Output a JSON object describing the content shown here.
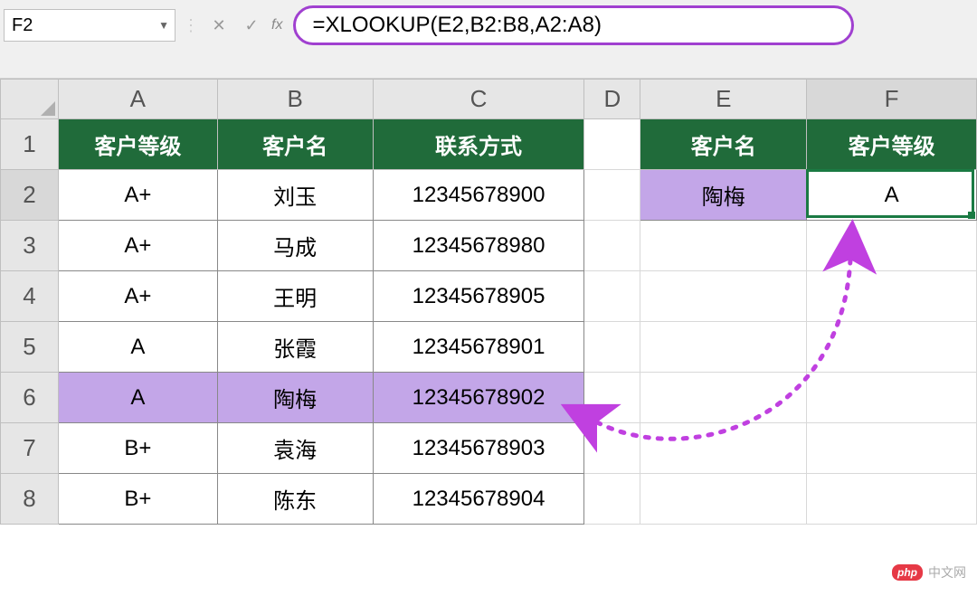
{
  "formula_bar": {
    "cell_ref": "F2",
    "formula": "=XLOOKUP(E2,B2:B8,A2:A8)"
  },
  "columns": [
    "A",
    "B",
    "C",
    "D",
    "E",
    "F"
  ],
  "rows": [
    "1",
    "2",
    "3",
    "4",
    "5",
    "6",
    "7",
    "8"
  ],
  "headers_left": {
    "A": "客户等级",
    "B": "客户名",
    "C": "联系方式"
  },
  "headers_right": {
    "E": "客户名",
    "F": "客户等级"
  },
  "table_left": [
    {
      "grade": "A+",
      "name": "刘玉",
      "phone": "12345678900"
    },
    {
      "grade": "A+",
      "name": "马成",
      "phone": "12345678980"
    },
    {
      "grade": "A+",
      "name": "王明",
      "phone": "12345678905"
    },
    {
      "grade": "A",
      "name": "张霞",
      "phone": "12345678901"
    },
    {
      "grade": "A",
      "name": "陶梅",
      "phone": "12345678902"
    },
    {
      "grade": "B+",
      "name": "袁海",
      "phone": "12345678903"
    },
    {
      "grade": "B+",
      "name": "陈东",
      "phone": "12345678904"
    }
  ],
  "lookup": {
    "name": "陶梅",
    "result": "A"
  },
  "highlight_row_index": 4,
  "watermark": {
    "badge": "php",
    "text": "中文网"
  },
  "chart_data": {
    "type": "table",
    "title": "XLOOKUP reverse lookup example",
    "columns": [
      "客户等级",
      "客户名",
      "联系方式"
    ],
    "rows": [
      [
        "A+",
        "刘玉",
        "12345678900"
      ],
      [
        "A+",
        "马成",
        "12345678980"
      ],
      [
        "A+",
        "王明",
        "12345678905"
      ],
      [
        "A",
        "张霞",
        "12345678901"
      ],
      [
        "A",
        "陶梅",
        "12345678902"
      ],
      [
        "B+",
        "袁海",
        "12345678903"
      ],
      [
        "B+",
        "陈东",
        "12345678904"
      ]
    ],
    "lookup_columns": [
      "客户名",
      "客户等级"
    ],
    "lookup_row": [
      "陶梅",
      "A"
    ],
    "formula": "=XLOOKUP(E2,B2:B8,A2:A8)"
  }
}
